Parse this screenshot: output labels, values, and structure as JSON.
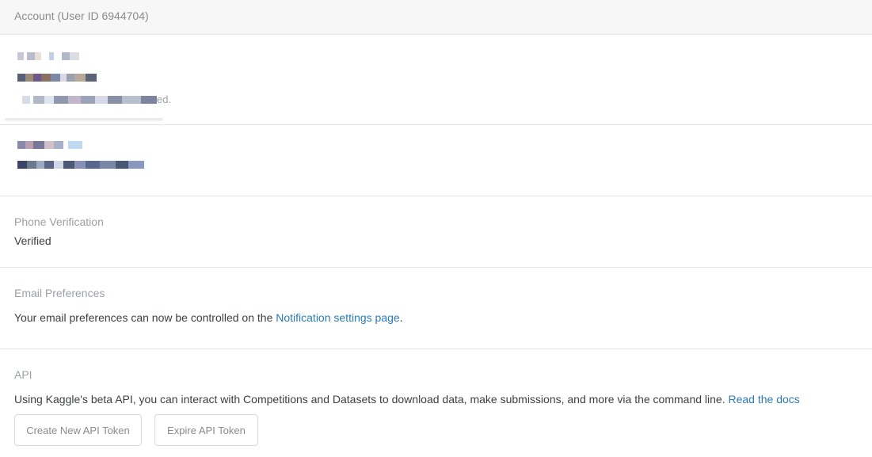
{
  "header": {
    "title": "Account (User ID 6944704)"
  },
  "sections": {
    "profile": {
      "suffix_text": "ed."
    },
    "phone": {
      "label": "Phone Verification",
      "value": "Verified"
    },
    "email_prefs": {
      "label": "Email Preferences",
      "text": "Your email preferences can now be controlled on the ",
      "link": "Notification settings page",
      "tail": "."
    },
    "api": {
      "label": "API",
      "text": "Using Kaggle's beta API, you can interact with Competitions and Datasets to download data, make submissions, and more via the command line. ",
      "link": "Read the docs",
      "create_button": "Create New API Token",
      "expire_button": "Expire API Token"
    }
  },
  "colors": {
    "link": "#2a7ab8",
    "label": "#9aa0a6",
    "text": "#3c4043"
  }
}
